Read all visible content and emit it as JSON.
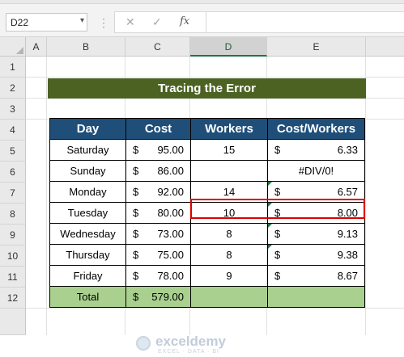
{
  "formula_bar": {
    "name_box": "D22",
    "name_box_dropdown": "▾",
    "separator": "⋮",
    "cancel_glyph": "✕",
    "enter_glyph": "✓",
    "fx_glyph": "fx",
    "formula": ""
  },
  "columns": [
    "A",
    "B",
    "C",
    "D",
    "E"
  ],
  "selected_column": "D",
  "rows": [
    "1",
    "2",
    "3",
    "4",
    "5",
    "6",
    "7",
    "8",
    "9",
    "10",
    "11",
    "12"
  ],
  "title": "Tracing the Error",
  "table": {
    "headers": [
      "Day",
      "Cost",
      "Workers",
      "Cost/Workers"
    ],
    "currency": "$",
    "rows": [
      {
        "day": "Saturday",
        "cost": "95.00",
        "workers": "15",
        "cpw": "6.33"
      },
      {
        "day": "Sunday",
        "cost": "86.00",
        "workers": "",
        "cpw": "#DIV/0!"
      },
      {
        "day": "Monday",
        "cost": "92.00",
        "workers": "14",
        "cpw": "6.57"
      },
      {
        "day": "Tuesday",
        "cost": "80.00",
        "workers": "10",
        "cpw": "8.00"
      },
      {
        "day": "Wednesday",
        "cost": "73.00",
        "workers": "8",
        "cpw": "9.13"
      },
      {
        "day": "Thursday",
        "cost": "75.00",
        "workers": "8",
        "cpw": "9.38"
      },
      {
        "day": "Friday",
        "cost": "78.00",
        "workers": "9",
        "cpw": "8.67"
      }
    ],
    "total": {
      "label": "Total",
      "cost": "579.00"
    }
  },
  "watermark": {
    "name": "exceldemy",
    "tagline": "EXCEL · DATA · BI"
  },
  "colors": {
    "title_bg": "#4b6223",
    "header_bg": "#1f4e78",
    "total_bg": "#a9d08e",
    "error_border": "#e00000",
    "excel_green": "#217346"
  }
}
